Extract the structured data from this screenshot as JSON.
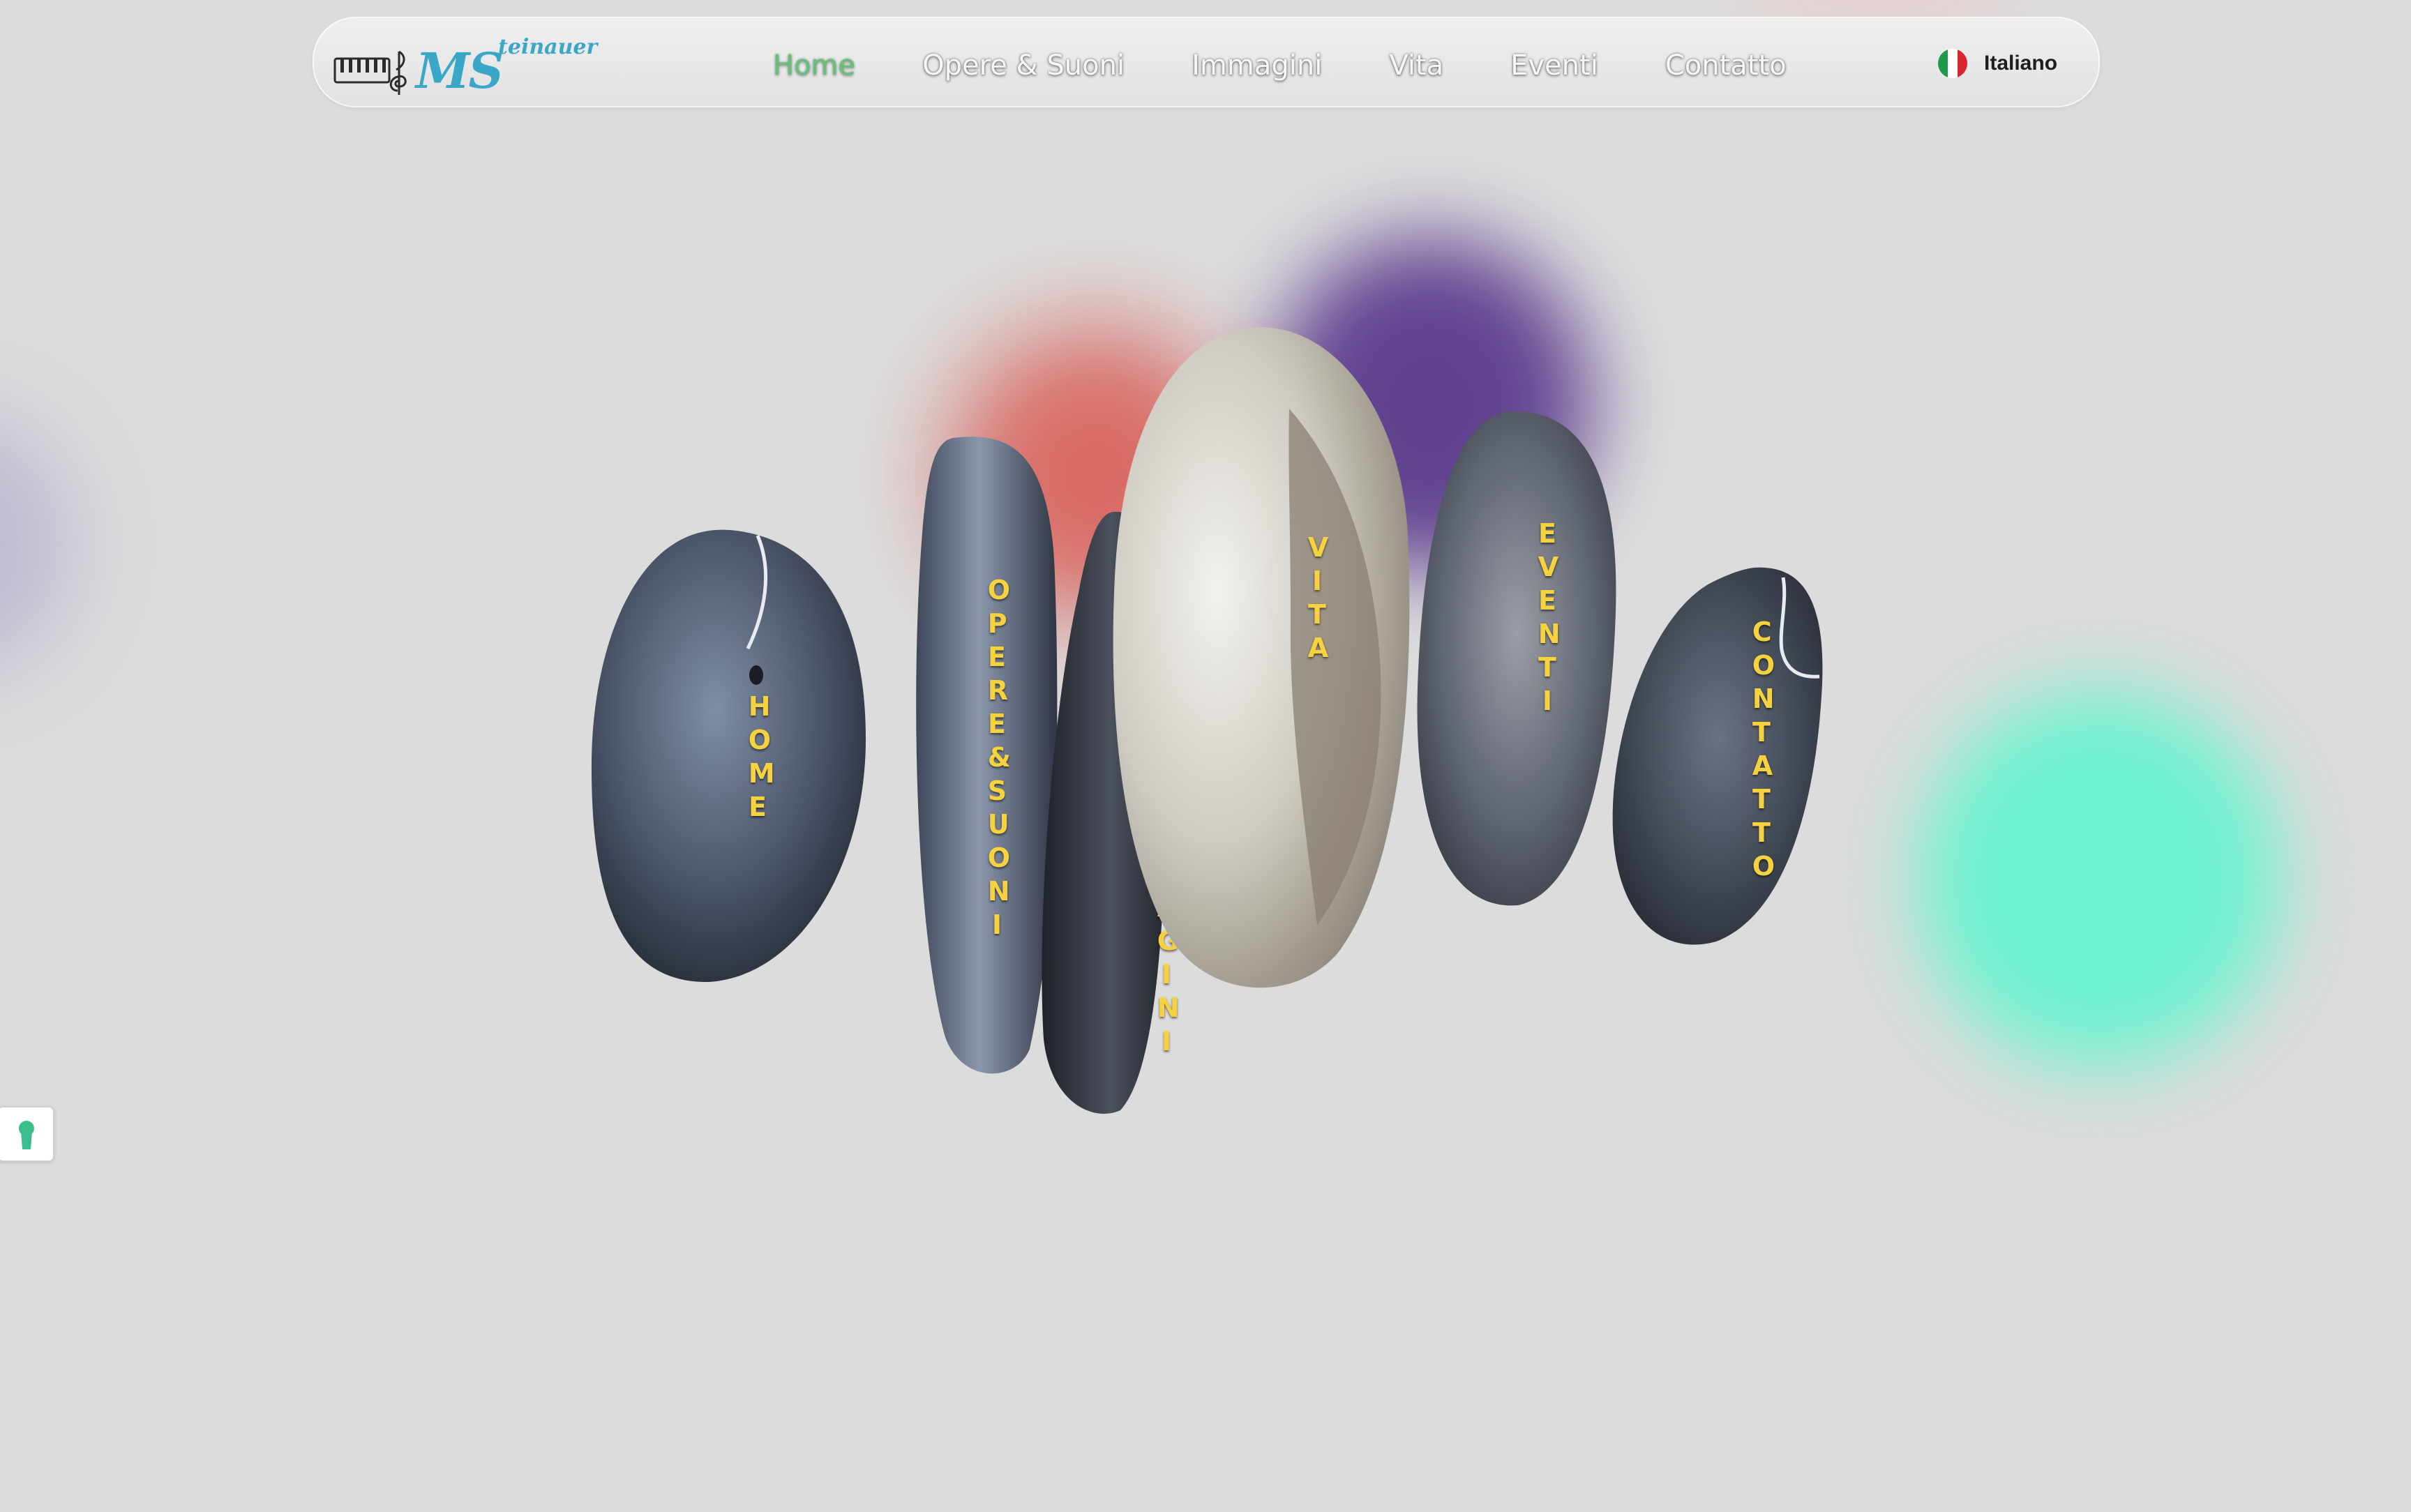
{
  "header": {
    "logo": {
      "main_text": "MS",
      "sub_text": "teinauer"
    },
    "nav_items": [
      {
        "label": "Home",
        "active": true
      },
      {
        "label": "Opere & Suoni",
        "active": false
      },
      {
        "label": "Immagini",
        "active": false
      },
      {
        "label": "Vita",
        "active": false
      },
      {
        "label": "Eventi",
        "active": false
      },
      {
        "label": "Contatto",
        "active": false
      }
    ],
    "language": {
      "label": "Italiano",
      "flag": "italy-flag-icon"
    }
  },
  "stones": [
    {
      "label": "HOME"
    },
    {
      "label": "OPERE & SUONI"
    },
    {
      "label": "IMMAGINI"
    },
    {
      "label": "VITA"
    },
    {
      "label": "EVENTI"
    },
    {
      "label": "CONTATTO"
    }
  ],
  "colors": {
    "background": "#dcdcdc",
    "active_nav": "#65c07a",
    "stone_label": "#f6d23e",
    "logo": "#3aa6c8",
    "blob_red": "#d9605a",
    "blob_purple": "#5a3a8c",
    "blob_mint": "#6ef3cf"
  },
  "cookie_button": {
    "icon": "keyhole-icon"
  }
}
